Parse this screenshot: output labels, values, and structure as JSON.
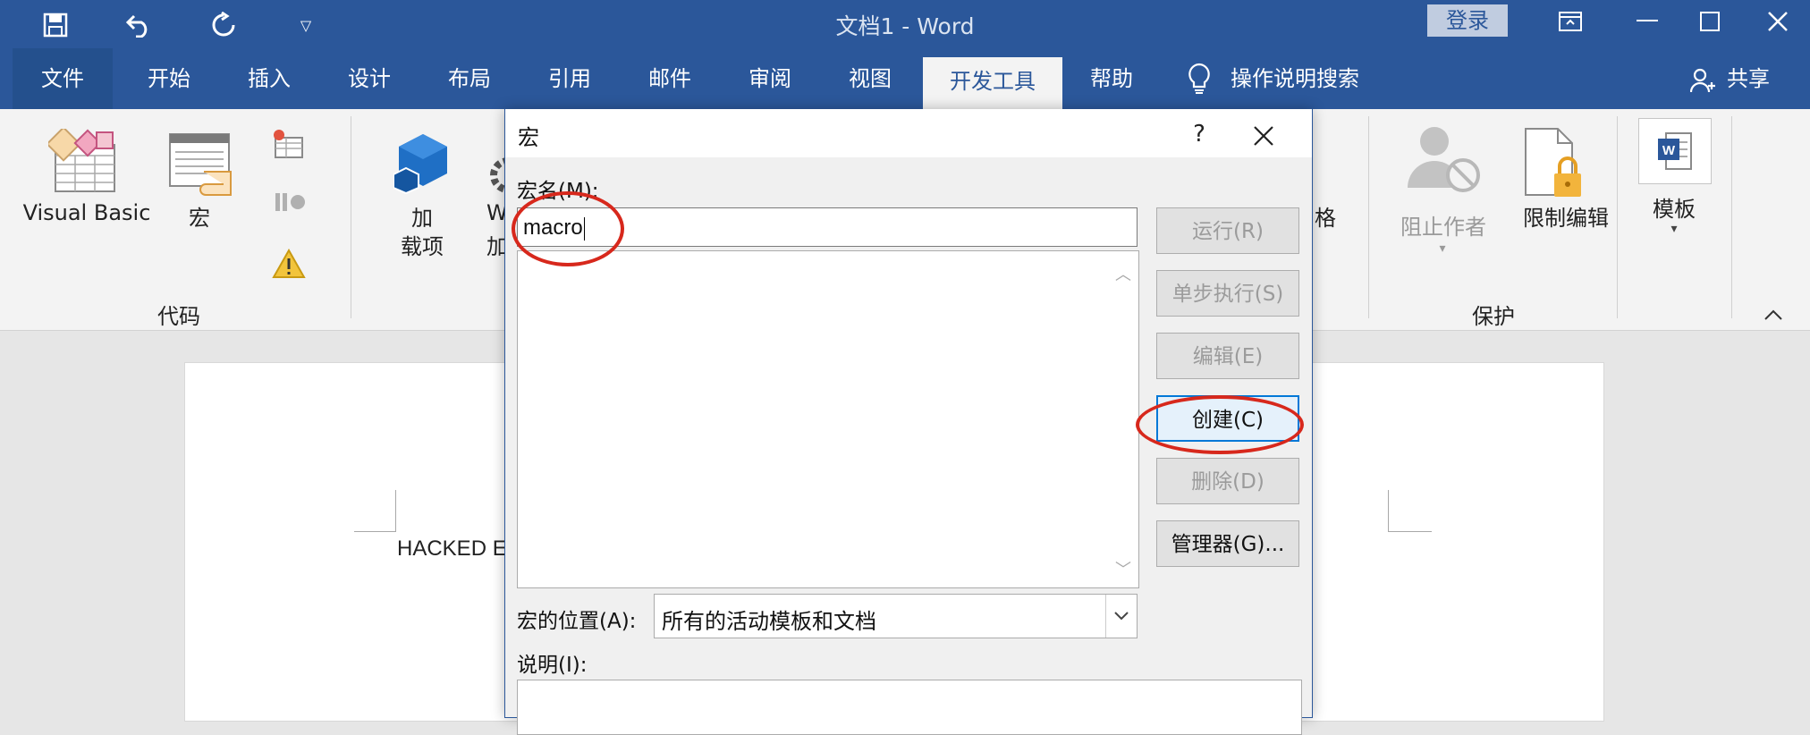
{
  "window": {
    "doc_title": "文档1  -  Word",
    "login_label": "登录",
    "share_label": "共享"
  },
  "quick_access": [
    "save-icon",
    "undo-icon",
    "redo-icon",
    "customize-qat-icon"
  ],
  "menu": {
    "tabs": [
      "文件",
      "开始",
      "插入",
      "设计",
      "布局",
      "引用",
      "邮件",
      "审阅",
      "视图",
      "开发工具",
      "帮助"
    ],
    "active_tab": "开发工具",
    "tell_me": "操作说明搜索"
  },
  "ribbon": {
    "code_group": {
      "label": "代码",
      "visual_basic": "Visual Basic",
      "macros": "宏"
    },
    "addins": {
      "addins_line1": "加",
      "addins_line2": "载项",
      "word_addins_partial_1": "W",
      "word_addins_partial_2": "加"
    },
    "partial_label": "格",
    "protect_group": {
      "label": "保护",
      "block_authors": "阻止作者",
      "restrict_editing": "限制编辑"
    },
    "templates": {
      "label": "模板"
    }
  },
  "document": {
    "visible_text": "HACKED E"
  },
  "dialog": {
    "title": "宏",
    "help": "?",
    "macro_name_label": "宏名(M):",
    "macro_name_value": "macro",
    "buttons": {
      "run": "运行(R)",
      "step_into": "单步执行(S)",
      "edit": "编辑(E)",
      "create": "创建(C)",
      "delete": "删除(D)",
      "organizer": "管理器(G)..."
    },
    "macros_in_label": "宏的位置(A):",
    "macros_in_value": "所有的活动模板和文档",
    "description_label": "说明(I):"
  },
  "colors": {
    "word_blue": "#2b579a",
    "annotation_red": "#d7281c"
  }
}
